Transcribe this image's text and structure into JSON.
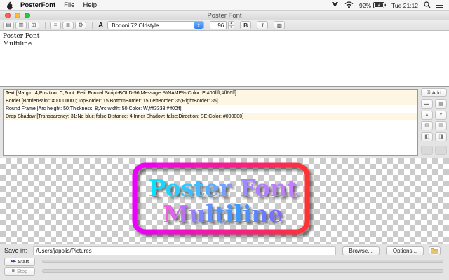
{
  "menubar": {
    "app_menu": "PosterFont",
    "menus": [
      "File",
      "Help"
    ],
    "battery_percent": "92%",
    "clock": "Tue 21:12"
  },
  "window": {
    "title": "Poster Font"
  },
  "toolbar": {
    "font_button_label": "A",
    "font_family": "Bodoni 72 Oldstyle",
    "font_size": "96",
    "bold_label": "B",
    "italic_label": "I"
  },
  "editor": {
    "line1": "Poster Font",
    "line2": "Multiline"
  },
  "style_list": {
    "rows": [
      "Text [Margin: 4;Position: C;Font: Petit Formal Script-BOLD-96;Message: %NAME%;Color: E,#00ffff,#ff66ff]",
      "Border [BorderPaint: #00000000;TopBorder: 15;BottomBorder: 15;LeftBorder: 35;RightBorder: 35]",
      "Round Frame [Arc height: 50;Thickness: 8;Arc width: 50;Color: W,#ff3333,#ff00ff]",
      "Drop Shadow [Transparency: 31;No blur: false;Distance: 4;Inner Shadow: false;Direction: SE;Color: #000000]"
    ],
    "add_label": "Add"
  },
  "preview": {
    "line1": "Poster Font",
    "line2": "Multiline",
    "frame_gradient_left": "#ee00ff",
    "frame_gradient_right": "#ff3333",
    "text_gradient_line1": [
      "#00e5ff",
      "#c77dff"
    ],
    "text_gradient_line2": [
      "#ff57e0",
      "#3b9bff",
      "#8a63ff"
    ],
    "shadow_color": "#000000"
  },
  "save_bar": {
    "label": "Save in:",
    "path": "/Users/japplis/Pictures",
    "browse_label": "Browse...",
    "options_label": "Options..."
  },
  "run_bar": {
    "start_label": "Start",
    "stop_label": "Stop"
  },
  "icons": {
    "popup_up": "▲",
    "popup_down": "▼",
    "stepper_up": "▲",
    "stepper_down": "▼",
    "move_up": "▲",
    "move_down": "▼",
    "start_arrows": "▶▶",
    "stop_square": "■",
    "tb_open": "▤",
    "tb_copy": "▥",
    "tb_export": "⊞",
    "tb_align": "≡",
    "tb_wrap": "≣",
    "tb_settings": "⚙",
    "tb_justify": "▩",
    "side_add": "⊞",
    "side_remove": "▬",
    "side_clear": "▦",
    "side_copy": "▤",
    "side_paste": "▥",
    "side_import": "◧",
    "side_export": "◨"
  }
}
